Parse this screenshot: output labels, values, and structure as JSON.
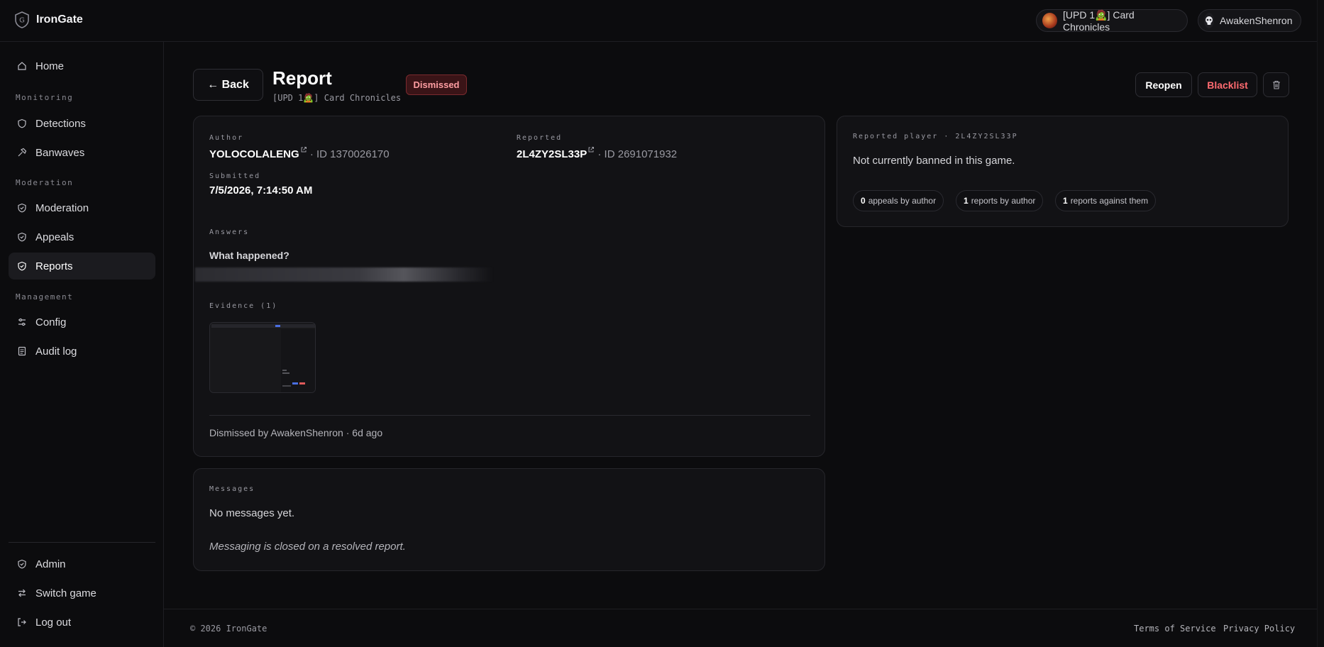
{
  "brand": {
    "name": "IronGate"
  },
  "topbar": {
    "game_selector": "[UPD 1🧟] Card Chronicles",
    "user": "AwakenShenron"
  },
  "sidebar": {
    "home": "Home",
    "sections": {
      "monitoring": "Monitoring",
      "moderation": "Moderation",
      "management": "Management"
    },
    "items": {
      "detections": "Detections",
      "banwaves": "Banwaves",
      "moderation": "Moderation",
      "appeals": "Appeals",
      "reports": "Reports",
      "config": "Config",
      "audit_log": "Audit log"
    },
    "bottom": {
      "admin": "Admin",
      "switch_game": "Switch game",
      "logout": "Log out"
    },
    "active": "reports"
  },
  "header": {
    "back_label": "← Back",
    "title": "Report",
    "subtitle": "[UPD 1🧟] Card Chronicles",
    "status": "Dismissed",
    "reopen_label": "Reopen",
    "blacklist_label": "Blacklist"
  },
  "report": {
    "author_label": "Author",
    "author_name": "YOLOCOLALENG",
    "author_id": "· ID 1370026170",
    "reported_label": "Reported",
    "reported_name": "2L4ZY2SL33P",
    "reported_id": "· ID 2691071932",
    "submitted_label": "Submitted",
    "submitted_value": "7/5/2026, 7:14:50 AM",
    "answers_label": "Answers",
    "question": "What happened?",
    "evidence_label": "Evidence (1)",
    "resolution_note": "Dismissed by AwakenShenron · 6d ago"
  },
  "messages": {
    "label": "Messages",
    "empty_text": "No messages yet.",
    "closed_text": "Messaging is closed on a resolved report."
  },
  "player_panel": {
    "label": "Reported player · 2L4ZY2SL33P",
    "status": "Not currently banned in this game.",
    "stats": [
      {
        "count": "0",
        "label": "appeals by author"
      },
      {
        "count": "1",
        "label": "reports by author"
      },
      {
        "count": "1",
        "label": "reports against them"
      }
    ]
  },
  "footer": {
    "copyright": "© 2026 IronGate",
    "terms": "Terms of Service",
    "privacy": "Privacy Policy"
  },
  "colors": {
    "background": "#0c0c0e",
    "card": "#121215",
    "danger": "#ff6b70",
    "badge_bg": "#3a1417"
  }
}
